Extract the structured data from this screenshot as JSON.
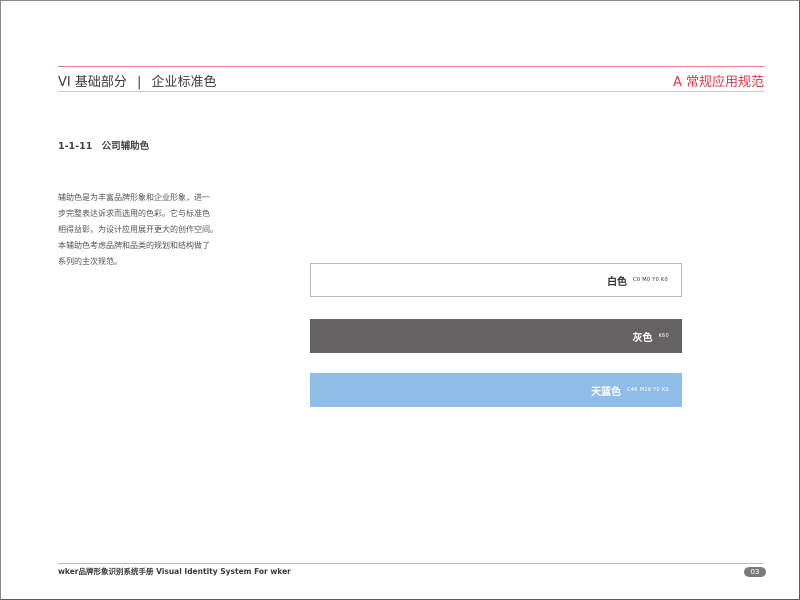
{
  "header": {
    "section": "VI 基础部分",
    "separator": "|",
    "topic": "企业标准色",
    "right_label": "A 常规应用规范"
  },
  "section": {
    "number": "1-1-11",
    "title": "公司辅助色"
  },
  "description": [
    "辅助色是为丰富品牌形象和企业形象，进一",
    "步完整表达诉求而选用的色彩。它与标准色",
    "相得益彰，为设计应用展开更大的创作空间。",
    "本辅助色考虑品牌和品类的规划和结构做了",
    "系列的主次规范。"
  ],
  "swatches": [
    {
      "name": "白色",
      "code": "C0 M0 Y0 K0",
      "color": "#ffffff"
    },
    {
      "name": "灰色",
      "code": "K60",
      "color": "#646263"
    },
    {
      "name": "天蓝色",
      "code": "C46 M18 Y0 K0",
      "color": "#90bde8"
    }
  ],
  "footer": {
    "text": "wker品牌形象识别系统手册  Visual Identity System For wker",
    "page_number": "03"
  },
  "colors": {
    "accent": "#d83a4a",
    "rule": "#e87f87"
  }
}
